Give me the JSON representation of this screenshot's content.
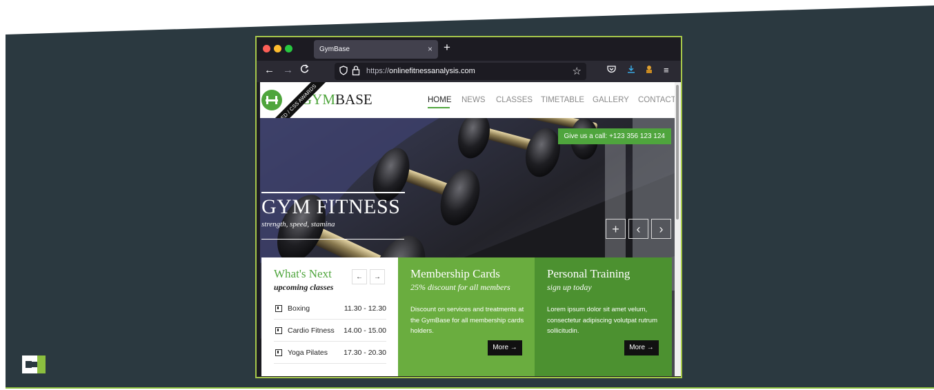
{
  "browser": {
    "tab_title": "GymBase",
    "tab_close": "×",
    "new_tab": "+",
    "url_prefix": "https://",
    "url_host": "onlinefitnessanalysis.com",
    "nav_back": "←",
    "nav_forward": "→",
    "nav_reload": "C"
  },
  "site": {
    "logo_text_gym": "GYM",
    "logo_text_base": "BASE",
    "ribbon": "FEATURED / CSS AWARDS",
    "menu": [
      "HOME",
      "NEWS",
      "CLASSES",
      "TIMETABLE",
      "GALLERY",
      "CONTACT"
    ]
  },
  "hero": {
    "call": "Give us a call: +123 356 123 124",
    "title": "GYM FITNESS",
    "subtitle": "strength, speed, stamina",
    "plus": "+",
    "prev": "‹",
    "next": "›"
  },
  "whats_next": {
    "title": "What's Next",
    "subtitle": "upcoming classes",
    "prev": "←",
    "next": "→",
    "classes": [
      {
        "name": "Boxing",
        "time": "11.30 - 12.30"
      },
      {
        "name": "Cardio Fitness",
        "time": "14.00 - 15.00"
      },
      {
        "name": "Yoga Pilates",
        "time": "17.30 - 20.30"
      }
    ]
  },
  "membership": {
    "title": "Membership Cards",
    "subtitle": "25% discount for all members",
    "text": "Discount on services and treatments at the GymBase for all membership cards holders.",
    "more": "More →"
  },
  "training": {
    "title": "Personal Training",
    "subtitle": "sign up today",
    "text": "Lorem ipsum dolor sit amet velum, consectetur adipiscing volutpat rutrum sollicitudin.",
    "more": "More →"
  },
  "colors": {
    "accent": "#8cbf3f",
    "site_green": "#4fa53d",
    "background": "#2b3940"
  }
}
